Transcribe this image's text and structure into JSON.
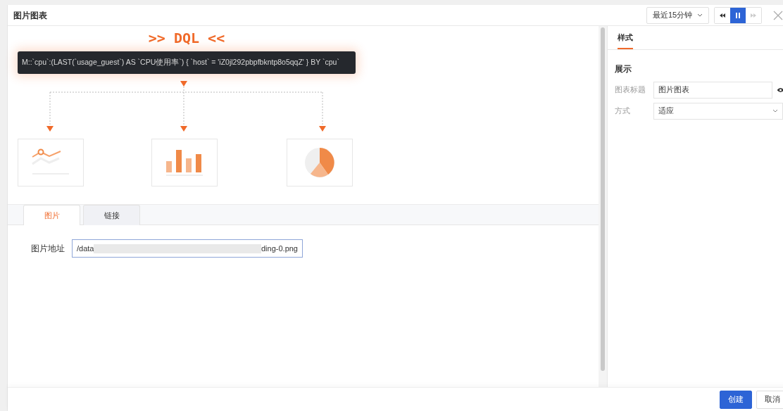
{
  "window": {
    "title": "图片图表"
  },
  "toolbar": {
    "time_range": "最近15分钟",
    "playback": [
      {
        "kind": "rewind",
        "selected": false,
        "disabled": false
      },
      {
        "kind": "pause",
        "selected": true,
        "disabled": false
      },
      {
        "kind": "forward",
        "selected": false,
        "disabled": true
      }
    ]
  },
  "illustration": {
    "heading": ">> DQL <<",
    "query": "M::`cpu`:(LAST(`usage_guest`) AS `CPU使用率`) { `host` = 'iZ0jl292pbpfbkntp8o5qqZ' } BY `cpu`",
    "charts": [
      {
        "kind": "line"
      },
      {
        "kind": "bar"
      },
      {
        "kind": "pie"
      }
    ]
  },
  "source_tabs": [
    {
      "label": "图片",
      "selected": true
    },
    {
      "label": "链接",
      "selected": false
    }
  ],
  "image_url": {
    "label": "图片地址",
    "value_start": "/data",
    "value_end": "ding-0.png",
    "redacted": true
  },
  "style_panel": {
    "tabs": [
      {
        "label": "样式",
        "selected": true
      }
    ],
    "section": "展示",
    "fields": [
      {
        "kind": "text",
        "label": "图表标题",
        "value": "图片图表",
        "visible": true
      },
      {
        "kind": "select",
        "label": "方式",
        "value": "适应"
      }
    ]
  },
  "footer": {
    "buttons": [
      {
        "label": "创建",
        "primary": true
      },
      {
        "label": "取消",
        "primary": false
      }
    ]
  }
}
